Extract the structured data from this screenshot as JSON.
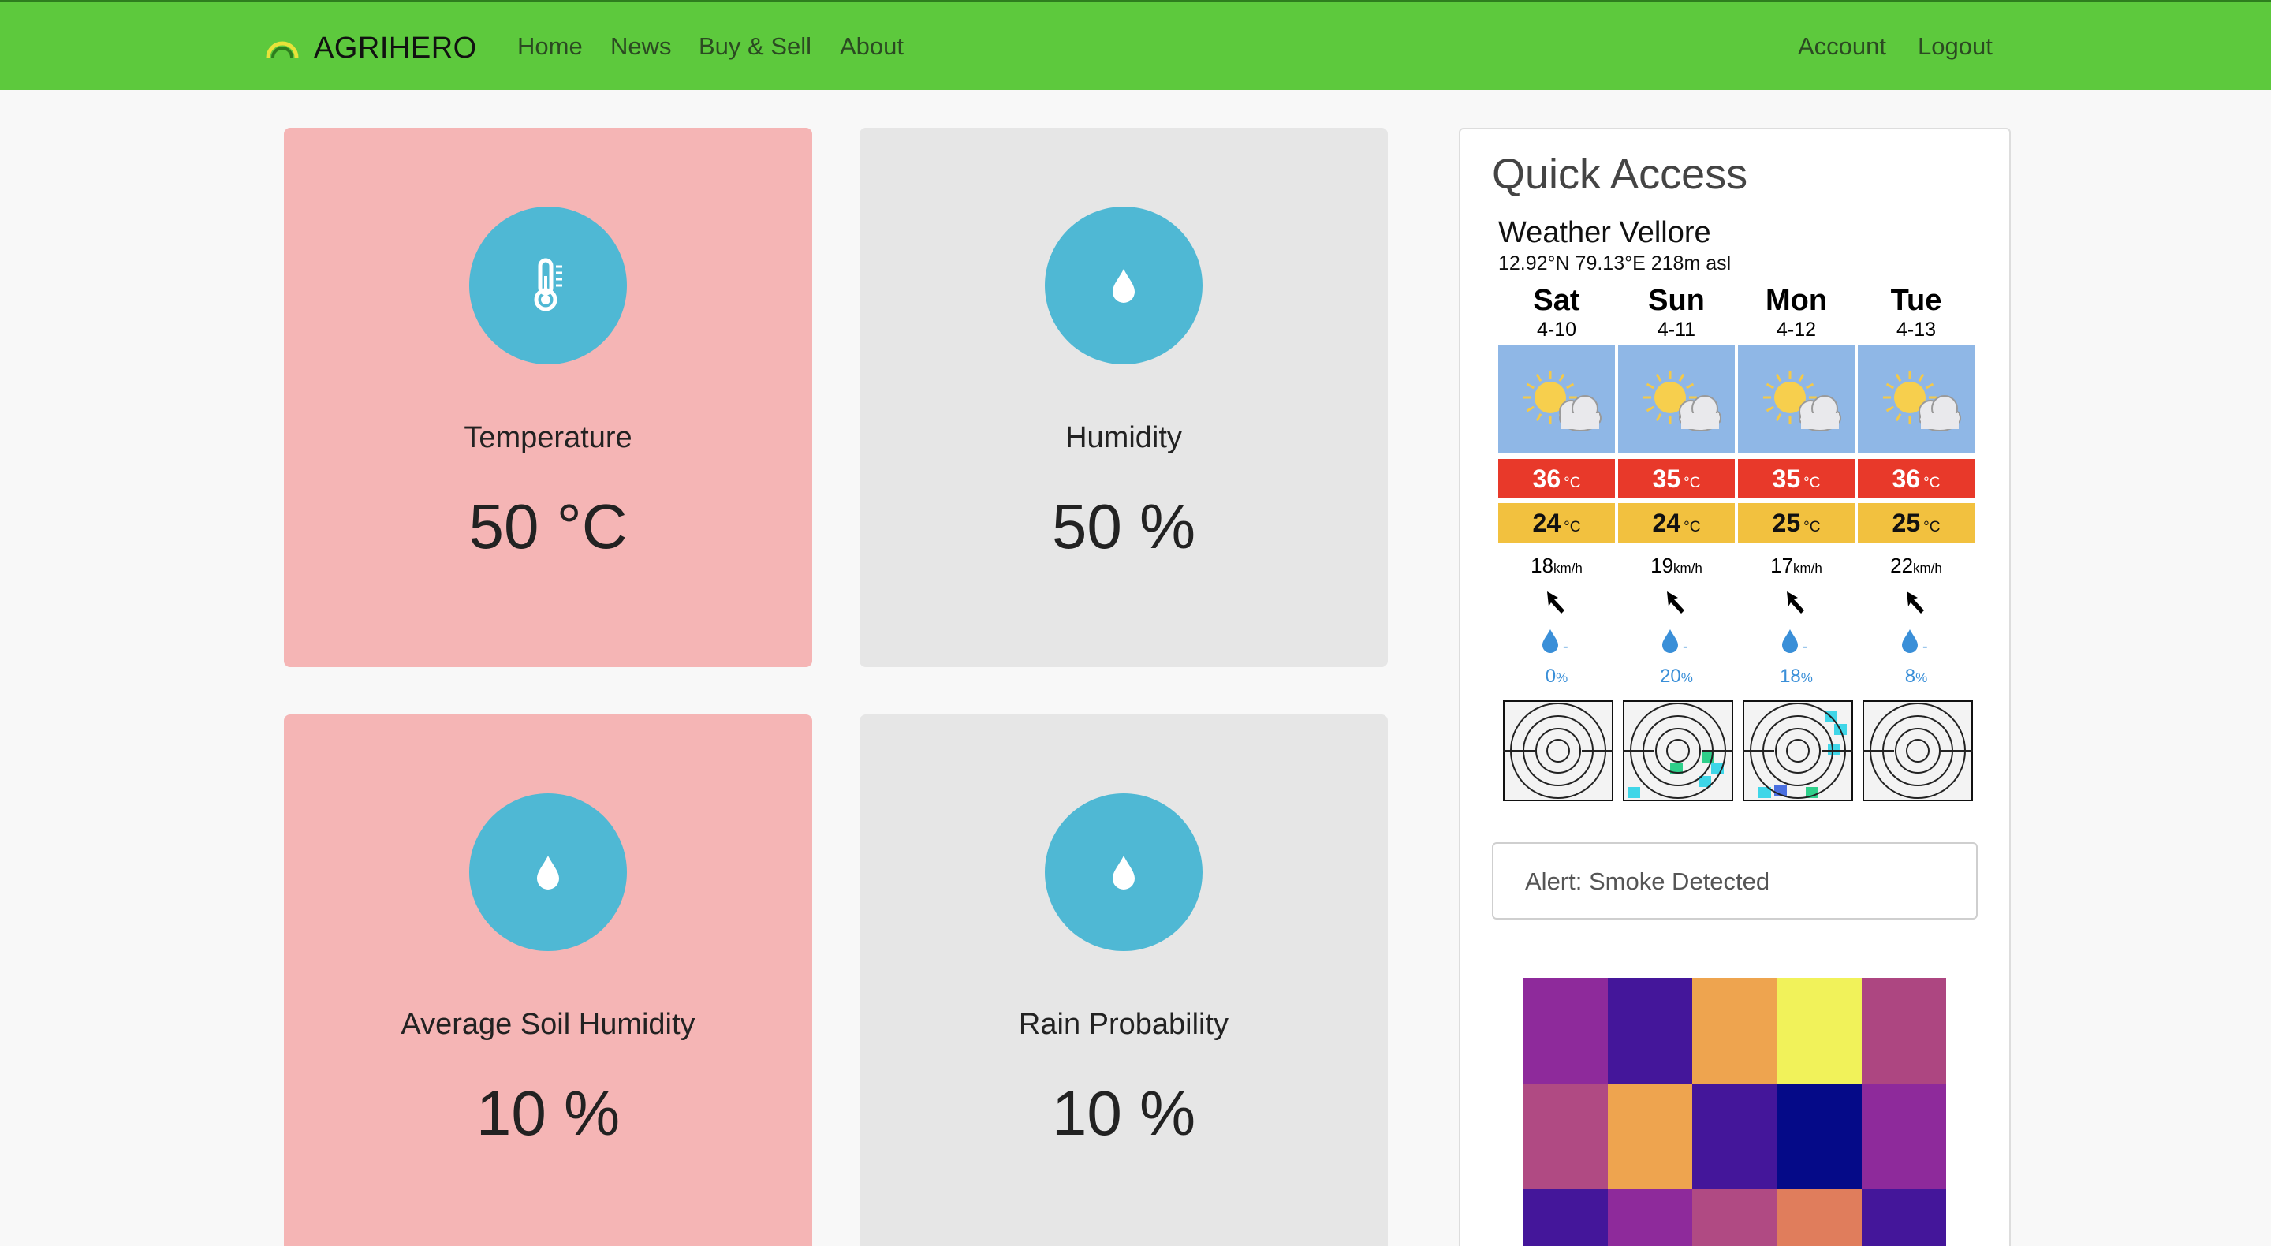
{
  "navbar": {
    "brand": "AGRIHERO",
    "links": [
      "Home",
      "News",
      "Buy & Sell",
      "About"
    ],
    "right_links": [
      "Account",
      "Logout"
    ],
    "bg_color": "#5dc93d"
  },
  "cards": [
    {
      "label": "Temperature",
      "value": "50 °C",
      "icon": "thermometer-icon",
      "color": "#f5b5b5"
    },
    {
      "label": "Humidity",
      "value": "50 %",
      "icon": "water-drop-icon",
      "color": "#e6e6e6"
    },
    {
      "label": "Average Soil Humidity",
      "value": "10 %",
      "icon": "water-drop-icon",
      "color": "#f5b5b5"
    },
    {
      "label": "Rain Probability",
      "value": "10 %",
      "icon": "water-drop-icon",
      "color": "#e6e6e6"
    }
  ],
  "quick_access": {
    "title": "Quick Access",
    "weather": {
      "title": "Weather Vellore",
      "coords": "12.92°N 79.13°E 218m asl",
      "temp_unit": "°C",
      "wind_unit": "km/h",
      "precip_unit": "%",
      "days": [
        {
          "name": "Sat",
          "date": "4-10",
          "high": "36",
          "low": "24",
          "wind": "18",
          "rain": "-",
          "precip": "0"
        },
        {
          "name": "Sun",
          "date": "4-11",
          "high": "35",
          "low": "24",
          "wind": "19",
          "rain": "-",
          "precip": "20"
        },
        {
          "name": "Mon",
          "date": "4-12",
          "high": "35",
          "low": "25",
          "wind": "17",
          "rain": "-",
          "precip": "18"
        },
        {
          "name": "Tue",
          "date": "4-13",
          "high": "36",
          "low": "25",
          "wind": "22",
          "rain": "-",
          "precip": "8"
        }
      ]
    },
    "alert": "Alert: Smoke Detected",
    "heatmap_colors": [
      [
        "#8e2a9b",
        "#44169a",
        "#eea44f",
        "#f1f25a",
        "#ad4681"
      ],
      [
        "#b04a83",
        "#eea44f",
        "#44169a",
        "#050a88",
        "#8e2a9b"
      ],
      [
        "#44169a",
        "#8e2a9b",
        "#b04a83",
        "#e07d5c",
        "#44169a"
      ]
    ]
  }
}
